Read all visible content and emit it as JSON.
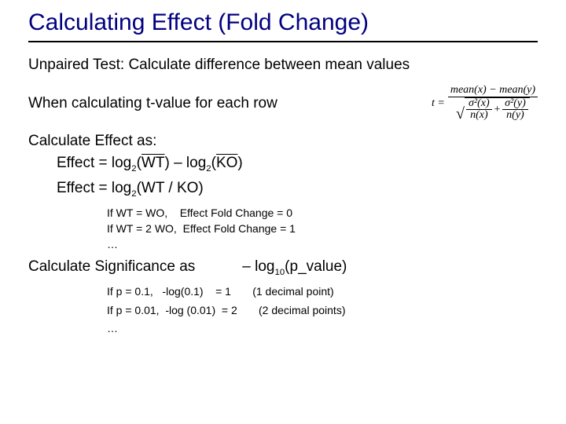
{
  "title": "Calculating Effect (Fold Change)",
  "line1": "Unpaired Test: Calculate difference between mean values",
  "line2": "When calculating t-value for each row",
  "tformula": {
    "lhs": "t =",
    "num": "mean(x) − mean(y)",
    "den1": {
      "num": "σ²(x)",
      "den": "n(x)"
    },
    "plus": "+",
    "den2": {
      "num": "σ²(y)",
      "den": "n(y)"
    }
  },
  "calcEffect": "Calculate Effect as:",
  "effect1_pre": "Effect = log",
  "effect1_sub1": "2",
  "effect1_mid1": "(",
  "effect1_wt": "WT",
  "effect1_mid2": ") – log",
  "effect1_sub2": "2",
  "effect1_mid3": "(",
  "effect1_ko": "KO",
  "effect1_end": ")",
  "effect2_pre": "Effect = log",
  "effect2_sub": "2",
  "effect2_rest": "(WT / KO)",
  "fc_line1": "If WT = WO,    Effect Fold Change = 0",
  "fc_line2": "If WT = 2 WO,  Effect Fold Change = 1",
  "ellipsis": "…",
  "calcSig": "Calculate Significance as",
  "sig_pre": "– log",
  "sig_sub": "10",
  "sig_rest": "(p_value)",
  "sig_line1": "If p = 0.1,   -log(0.1)    = 1       (1 decimal point)",
  "sig_line2": "If p = 0.01,  -log (0.01)  = 2       (2 decimal points)"
}
